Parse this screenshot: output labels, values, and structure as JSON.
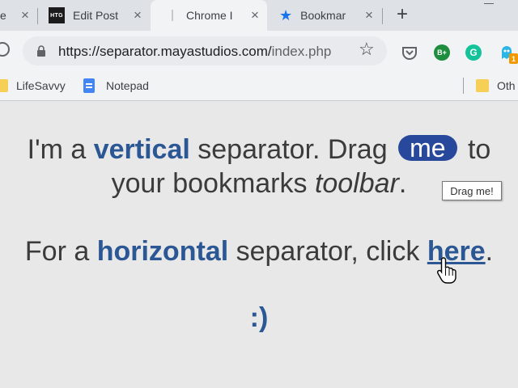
{
  "tabs": [
    {
      "title": "e",
      "favicon": "none",
      "active": false
    },
    {
      "title": "Edit Post",
      "favicon": "htg-logo-icon",
      "favicon_text": "HTG",
      "active": false
    },
    {
      "title": "Chrome I",
      "favicon": "blank-icon",
      "active": true
    },
    {
      "title": "Bookmar",
      "favicon": "star-icon",
      "active": false
    }
  ],
  "new_tab_label": "+",
  "address_bar": {
    "url_main": "https://separator.mayastudios.com/",
    "url_path": "index.php"
  },
  "extensions": [
    {
      "name": "pocket-icon"
    },
    {
      "name": "bplus-icon",
      "text": "B+"
    },
    {
      "name": "grammarly-icon",
      "text": "G"
    },
    {
      "name": "ghostery-icon",
      "badge": "1"
    }
  ],
  "bookmarks": [
    {
      "label": "LifeSavvy",
      "icon": "folder-icon"
    },
    {
      "label": "Notepad",
      "icon": "document-icon"
    },
    {
      "label": "Oth",
      "icon": "folder-icon"
    }
  ],
  "page": {
    "line1": {
      "a": "I'm a ",
      "b": "vertical",
      "c": " separator. Drag ",
      "d": "me",
      "e": " to"
    },
    "line2": {
      "a": "your bookmarks ",
      "b": "toolbar",
      "c": "."
    },
    "line3": {
      "a": "For a ",
      "b": "horizontal",
      "c": " separator, click ",
      "d": "here",
      "e": "."
    },
    "smiley": ":)",
    "tooltip": "Drag me!"
  },
  "colors": {
    "accent_blue": "#2b5795",
    "pill_blue": "#28499b",
    "page_bg": "#e8e8e8"
  }
}
